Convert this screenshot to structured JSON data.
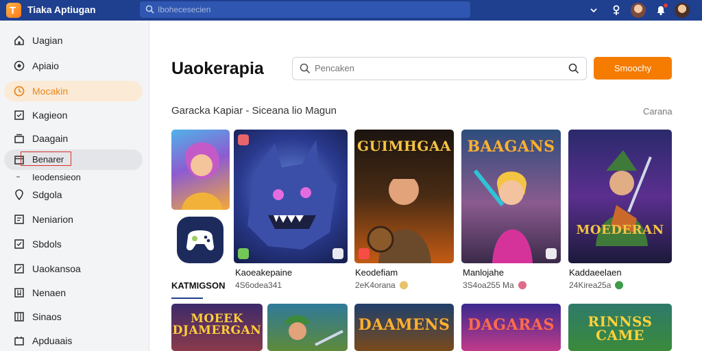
{
  "app": {
    "title": "Tiaka Aptiugan",
    "logo_letter": "T"
  },
  "topbar": {
    "search_placeholder": "Ibohecesecien",
    "icons": [
      "chevron-down-icon",
      "pin-icon",
      "user-avatar-icon",
      "notification-icon",
      "profile-avatar-icon"
    ]
  },
  "sidebar": {
    "items": [
      {
        "label": "Uagian",
        "icon": "home-icon"
      },
      {
        "label": "Apiaio",
        "icon": "compass-icon"
      },
      {
        "label": "Mocakin",
        "icon": "clock-icon",
        "active": true
      },
      {
        "label": "Kagieon",
        "icon": "box-icon"
      },
      {
        "label": "Daagain",
        "icon": "library-icon"
      },
      {
        "label": "Benarer",
        "icon": "calendar-icon",
        "selected": true
      },
      {
        "label": "Ieodensieon",
        "icon": "dot-icon"
      },
      {
        "label": "Sdgola",
        "icon": "location-icon"
      },
      {
        "label": "Neniarion",
        "icon": "list-icon"
      },
      {
        "label": "Sbdols",
        "icon": "check-box-icon"
      },
      {
        "label": "Uaokansoa",
        "icon": "edit-icon"
      },
      {
        "label": "Nenaen",
        "icon": "bookmark-icon"
      },
      {
        "label": "Sinaos",
        "icon": "grid-icon"
      },
      {
        "label": "Apduaais",
        "icon": "apps-icon"
      }
    ]
  },
  "main": {
    "title": "Uaokerapia",
    "search_placeholder": "Pencaken",
    "search_button": "Smoochy",
    "section_title": "Garacka  Kapiar  -  Siceana lio Magun",
    "section_link": "Carana",
    "category_label": "KATMIGSON",
    "cover_texts": [
      "GUIMHGAA",
      "BAAGANS",
      "MOEDERAN",
      "MOEEK DJAMERGAN",
      "DAAMENS",
      "DAGARAS",
      "RINNSS CAME"
    ],
    "games": [
      {
        "name": "Kaoeakepaine",
        "meta": "4S6odea341"
      },
      {
        "name": "Keodefiam",
        "meta": "2eK4orana"
      },
      {
        "name": "Manlojahe",
        "meta": "3S4oa255 Ma"
      },
      {
        "name": "Kaddaeelaen",
        "meta": "24Kirea25a"
      }
    ]
  },
  "colors": {
    "topbar": "#1f3f8f",
    "accent": "#f57c00",
    "sidebar_bg": "#f3f4f6",
    "active_item": "#fbead6"
  }
}
